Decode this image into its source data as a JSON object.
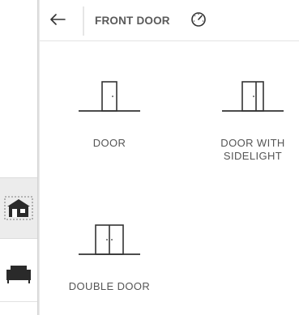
{
  "header": {
    "back_icon": "arrow-left-icon",
    "title": "FRONT DOOR",
    "gauge_icon": "gauge-icon"
  },
  "rail": {
    "items": [
      {
        "icon": "house-icon",
        "active": true
      },
      {
        "icon": "sofa-icon",
        "active": false
      }
    ]
  },
  "options": [
    {
      "label": "DOOR",
      "icon": "single-door-icon"
    },
    {
      "label": "DOOR WITH SIDELIGHT",
      "icon": "door-with-sidelight-icon"
    },
    {
      "label": "DOUBLE DOOR",
      "icon": "double-door-icon"
    }
  ],
  "colors": {
    "text": "#555555",
    "line": "#333333",
    "active_rail_bg": "#ececec"
  }
}
